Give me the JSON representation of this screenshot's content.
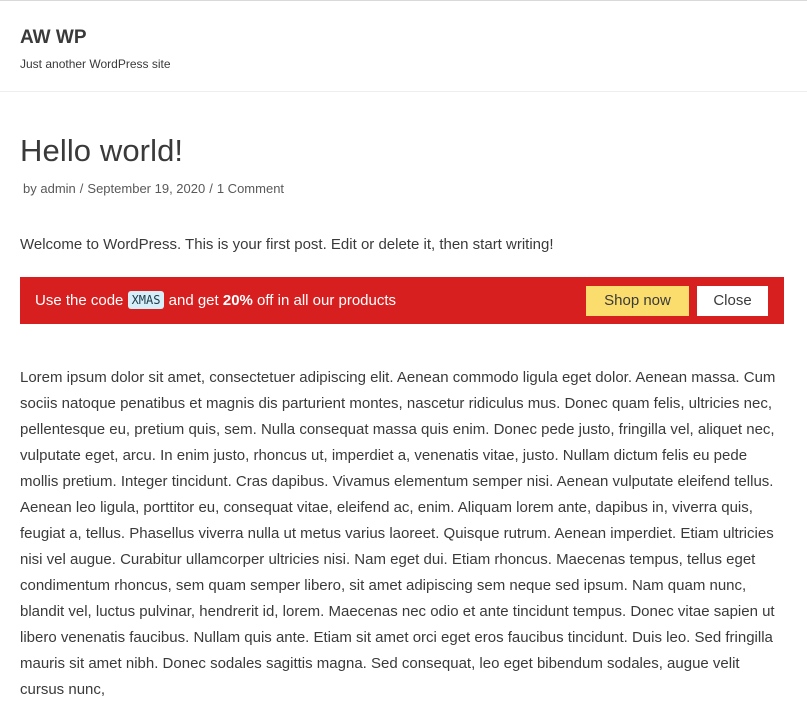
{
  "header": {
    "site_title": "AW WP",
    "site_description": "Just another WordPress site"
  },
  "post": {
    "title": "Hello world!",
    "meta": {
      "author_prefix": "by",
      "author": "admin",
      "date": "September 19, 2020",
      "comments": "1 Comment",
      "separator": "/"
    },
    "intro": "Welcome to WordPress. This is your first post. Edit or delete it, then start writing!",
    "body": "Lorem ipsum dolor sit amet, consectetuer adipiscing elit. Aenean commodo ligula eget dolor. Aenean massa. Cum sociis natoque penatibus et magnis dis parturient montes, nascetur ridiculus mus. Donec quam felis, ultricies nec, pellentesque eu, pretium quis, sem. Nulla consequat massa quis enim. Donec pede justo, fringilla vel, aliquet nec, vulputate eget, arcu. In enim justo, rhoncus ut, imperdiet a, venenatis vitae, justo. Nullam dictum felis eu pede mollis pretium. Integer tincidunt. Cras dapibus. Vivamus elementum semper nisi. Aenean vulputate eleifend tellus. Aenean leo ligula, porttitor eu, consequat vitae, eleifend ac, enim. Aliquam lorem ante, dapibus in, viverra quis, feugiat a, tellus. Phasellus viverra nulla ut metus varius laoreet. Quisque rutrum. Aenean imperdiet. Etiam ultricies nisi vel augue. Curabitur ullamcorper ultricies nisi. Nam eget dui. Etiam rhoncus. Maecenas tempus, tellus eget condimentum rhoncus, sem quam semper libero, sit amet adipiscing sem neque sed ipsum. Nam quam nunc, blandit vel, luctus pulvinar, hendrerit id, lorem. Maecenas nec odio et ante tincidunt tempus. Donec vitae sapien ut libero venenatis faucibus. Nullam quis ante. Etiam sit amet orci eget eros faucibus tincidunt. Duis leo. Sed fringilla mauris sit amet nibh. Donec sodales sagittis magna. Sed consequat, leo eget bibendum sodales, augue velit cursus nunc,"
  },
  "promo": {
    "text_before_code": "Use the code ",
    "code": "XMAS",
    "text_middle": " and get ",
    "discount": "20%",
    "text_after": " off in all our products",
    "shop_button_label": "Shop now",
    "close_button_label": "Close",
    "colors": {
      "bar_background": "#d81f1f",
      "shop_button": "#fbdd6d",
      "code_background": "#d6eef8"
    }
  }
}
